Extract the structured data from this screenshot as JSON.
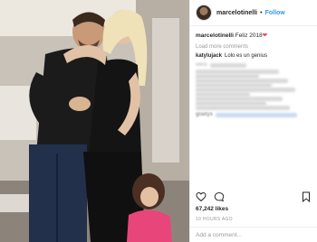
{
  "header": {
    "username": "marcelotinelli",
    "separator": "•",
    "follow_label": "Follow"
  },
  "caption": {
    "username": "marcelotinelli",
    "text": "Feliz 2018",
    "emoji": "❤"
  },
  "load_more_label": "Load more comments",
  "comments": [
    {
      "user": "katylujack",
      "text": "Lolo es un genius"
    },
    {
      "user": "vero",
      "text": ""
    },
    {
      "user": "",
      "text": ""
    },
    {
      "user": "",
      "text": ""
    },
    {
      "user": "",
      "text": ""
    },
    {
      "user": "",
      "text": ""
    },
    {
      "user": "",
      "text": ""
    },
    {
      "user": "",
      "text": ""
    },
    {
      "user": "",
      "text": ""
    },
    {
      "user": "",
      "text": ""
    },
    {
      "user": "",
      "text": ""
    },
    {
      "user": "gladys",
      "text": ""
    }
  ],
  "likes": "67,242 likes",
  "time": "10 HOURS AGO",
  "add_comment_placeholder": "Add a comment...",
  "icons": {
    "like": "heart-outline-icon",
    "comment": "comment-bubble-icon",
    "save": "bookmark-icon"
  },
  "colors": {
    "link": "#3897f0",
    "heart": "#ed4956"
  }
}
